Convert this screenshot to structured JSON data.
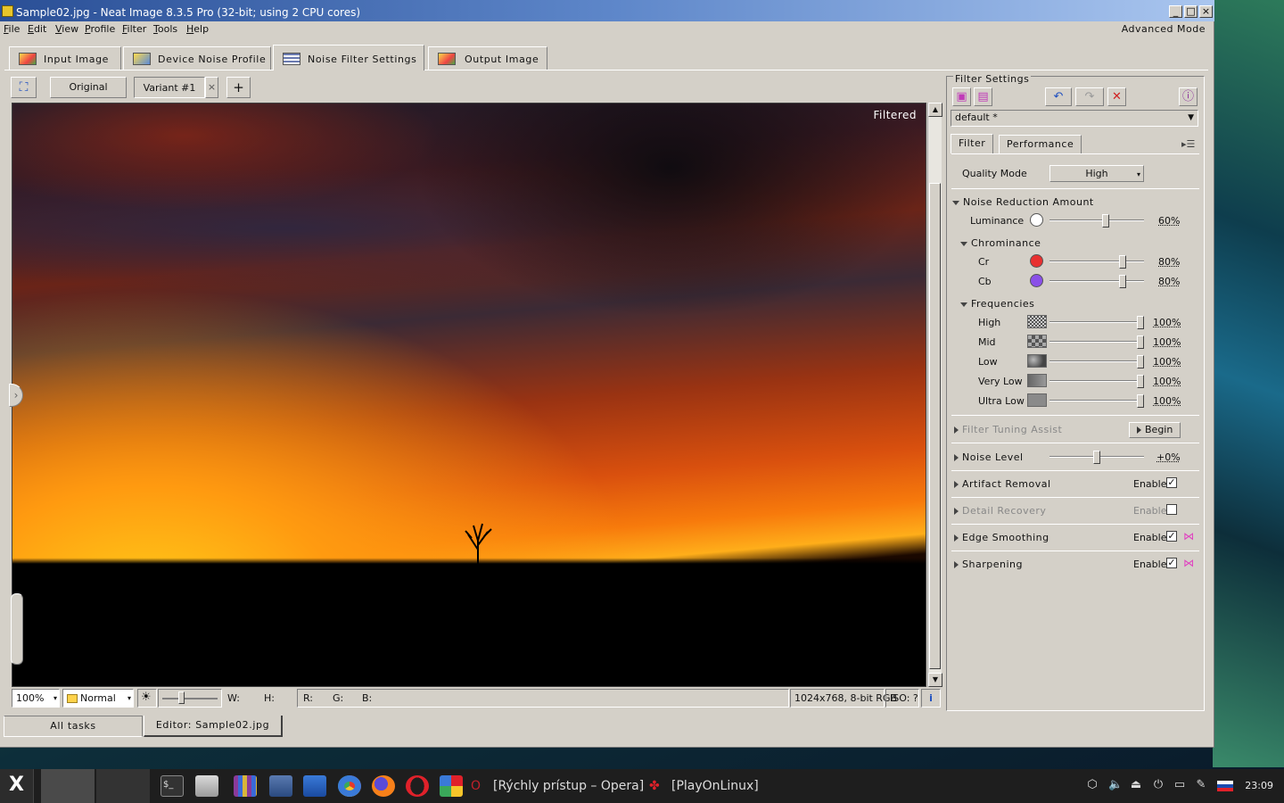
{
  "window": {
    "title": "Sample02.jpg - Neat Image 8.3.5 Pro (32-bit; using 2 CPU cores)",
    "controls": [
      "_",
      "□",
      "×"
    ]
  },
  "menu": {
    "items": [
      "File",
      "Edit",
      "View",
      "Profile",
      "Filter",
      "Tools",
      "Help"
    ],
    "advanced_mode": "Advanced Mode"
  },
  "main_tabs": [
    {
      "label": "Input Image"
    },
    {
      "label": "Device Noise Profile"
    },
    {
      "label": "Noise Filter Settings",
      "active": true
    },
    {
      "label": "Output Image"
    }
  ],
  "variants": {
    "original": "Original",
    "variant": "Variant #1",
    "close": "×",
    "add": "+"
  },
  "viewer": {
    "overlay_label": "Filtered"
  },
  "statusbar": {
    "zoom": "100%",
    "mode": "Normal",
    "w_label": "W:",
    "h_label": "H:",
    "r_label": "R:",
    "g_label": "G:",
    "b_label": "B:",
    "image_info": "1024x768, 8-bit RGB",
    "iso": "ISO: ?",
    "info_icon": "i"
  },
  "filter_settings": {
    "group_label": "Filter Settings",
    "preset": "default *",
    "sub_tabs": [
      "Filter",
      "Performance"
    ],
    "quality_mode_label": "Quality Mode",
    "quality_mode_value": "High",
    "noise_reduction_title": "Noise Reduction Amount",
    "luminance": {
      "label": "Luminance",
      "value_text": "60%",
      "value": 60,
      "color": "#ffffff"
    },
    "chrominance_title": "Chrominance",
    "cr": {
      "label": "Cr",
      "value_text": "80%",
      "value": 80,
      "color": "#e83030"
    },
    "cb": {
      "label": "Cb",
      "value_text": "80%",
      "value": 80,
      "color": "#8a50e8"
    },
    "frequencies_title": "Frequencies",
    "frequencies": [
      {
        "label": "High",
        "value_text": "100%",
        "value": 100
      },
      {
        "label": "Mid",
        "value_text": "100%",
        "value": 100
      },
      {
        "label": "Low",
        "value_text": "100%",
        "value": 100
      },
      {
        "label": "Very Low",
        "value_text": "100%",
        "value": 100
      },
      {
        "label": "Ultra Low",
        "value_text": "100%",
        "value": 100
      }
    ],
    "tuning_assist_title": "Filter Tuning Assist",
    "begin_label": "Begin",
    "noise_level_title": "Noise Level",
    "noise_level_value_text": "+0%",
    "noise_level_value": 0,
    "sections": [
      {
        "title": "Artifact Removal",
        "enable_label": "Enable",
        "checked": true,
        "extra_icon": false,
        "disabled": false
      },
      {
        "title": "Detail Recovery",
        "enable_label": "Enable",
        "checked": false,
        "extra_icon": false,
        "disabled": true
      },
      {
        "title": "Edge Smoothing",
        "enable_label": "Enable",
        "checked": true,
        "extra_icon": true,
        "disabled": false
      },
      {
        "title": "Sharpening",
        "enable_label": "Enable",
        "checked": true,
        "extra_icon": true,
        "disabled": false
      }
    ]
  },
  "bottom_tabs": [
    "All tasks",
    "Editor: Sample02.jpg"
  ],
  "taskbar": {
    "opera_label": "[Rýchly prístup – Opera]",
    "playonlinux_label": "[PlayOnLinux]",
    "clock": "23:09"
  }
}
